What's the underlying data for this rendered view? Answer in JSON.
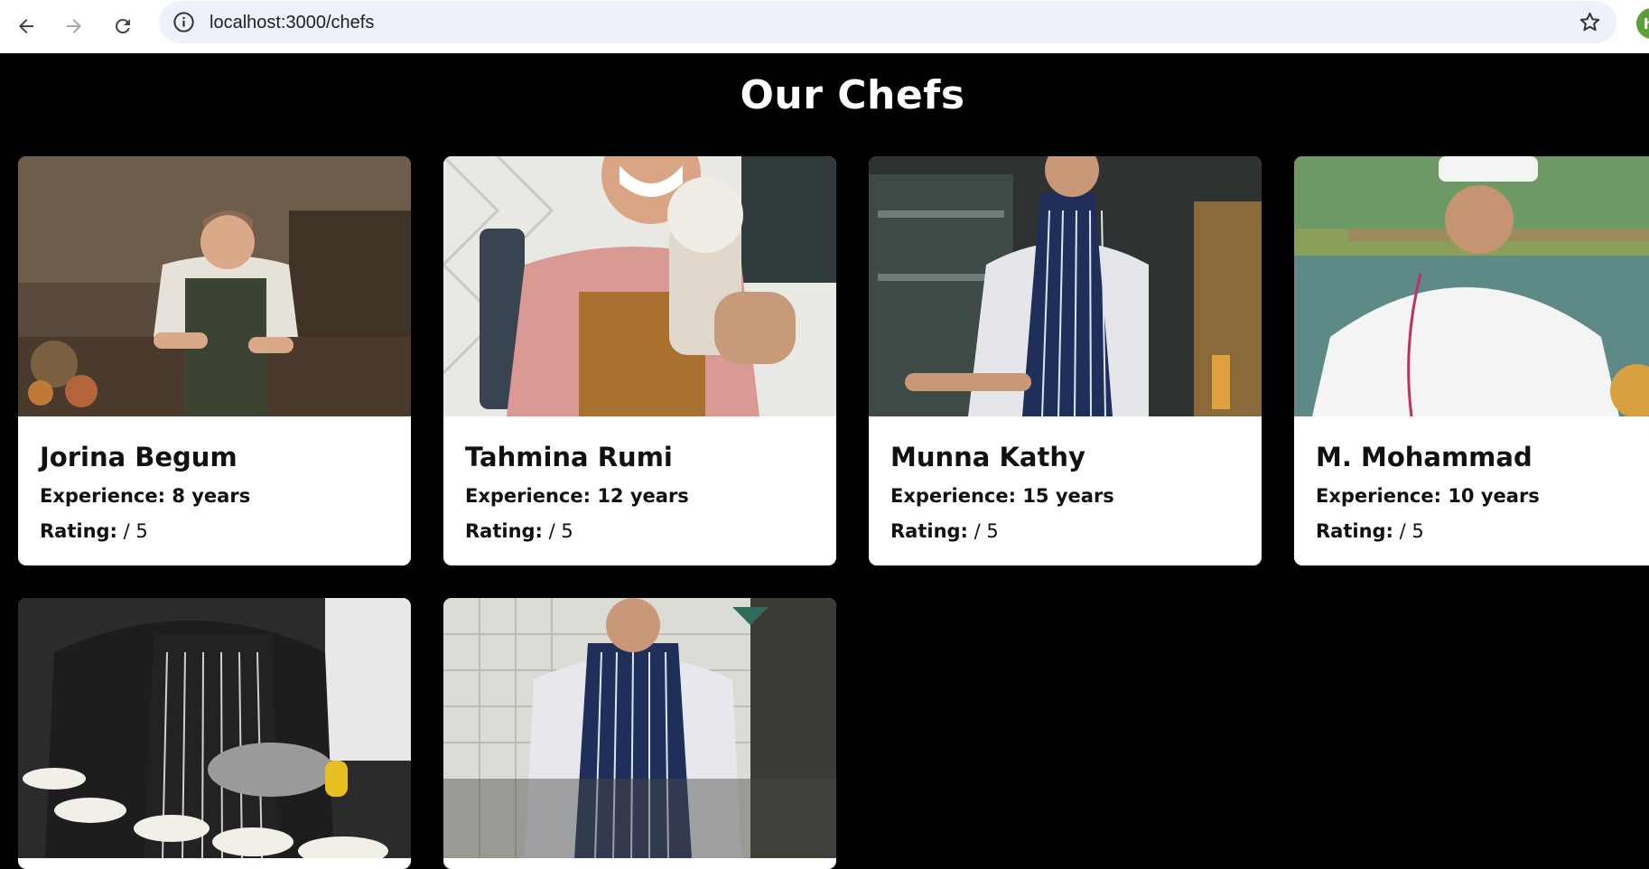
{
  "browser": {
    "url": "localhost:3000/chefs",
    "profile_initial": "h",
    "icons": [
      "back-arrow-icon",
      "forward-arrow-icon",
      "reload-icon",
      "site-info-icon",
      "bookmark-star-icon"
    ]
  },
  "page": {
    "title": "Our Chefs"
  },
  "chefs": [
    {
      "name": "Jorina Begum",
      "experience": "Experience: 8 years",
      "rating_label": "Rating:",
      "rating_value": "/ 5"
    },
    {
      "name": "Tahmina Rumi",
      "experience": "Experience: 12 years",
      "rating_label": "Rating:",
      "rating_value": "/ 5"
    },
    {
      "name": "Munna Kathy",
      "experience": "Experience: 15 years",
      "rating_label": "Rating:",
      "rating_value": "/ 5"
    },
    {
      "name": "M. Mohammad",
      "experience": "Experience: 10 years",
      "rating_label": "Rating:",
      "rating_value": "/ 5"
    }
  ],
  "colors": {
    "page_background": "#000000",
    "card_background": "#ffffff",
    "text": "#111111",
    "omnibox": "#edf2fa"
  }
}
